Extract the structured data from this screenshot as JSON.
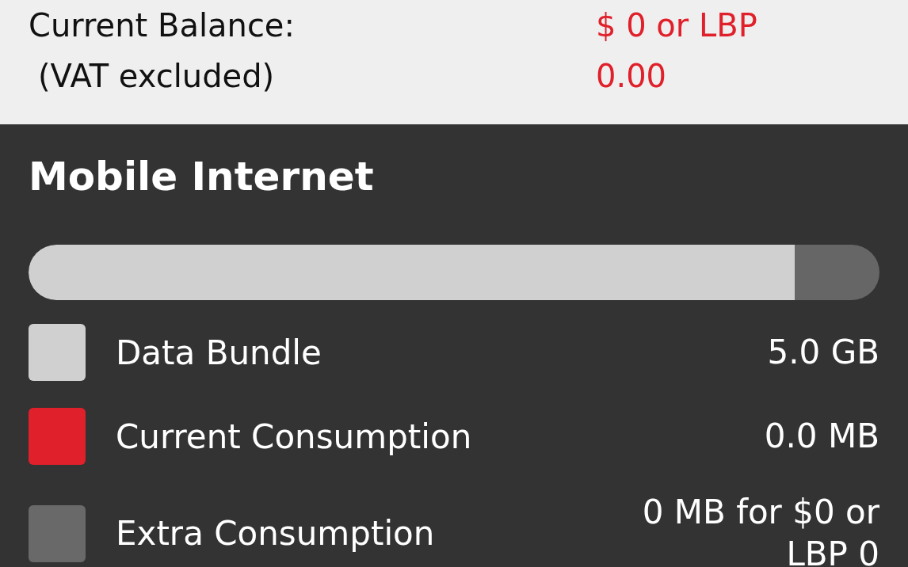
{
  "balance": {
    "label": "Current Balance:",
    "note": "(VAT excluded)",
    "value_line_1": "$ 0 or LBP",
    "value_line_2": "0.00"
  },
  "mobile_internet": {
    "title": "Mobile Internet",
    "usage_bar": {
      "level": 0.9
    },
    "legend": [
      {
        "label": "Data Bundle",
        "value": "5.0 GB",
        "color": "#d0d0d0"
      },
      {
        "label": "Current Consumption",
        "value": "0.0 MB",
        "color": "#e0202a"
      },
      {
        "label": "Extra Consumption",
        "value": "0 MB for $0 or LBP 0",
        "color": "#696969"
      }
    ]
  }
}
